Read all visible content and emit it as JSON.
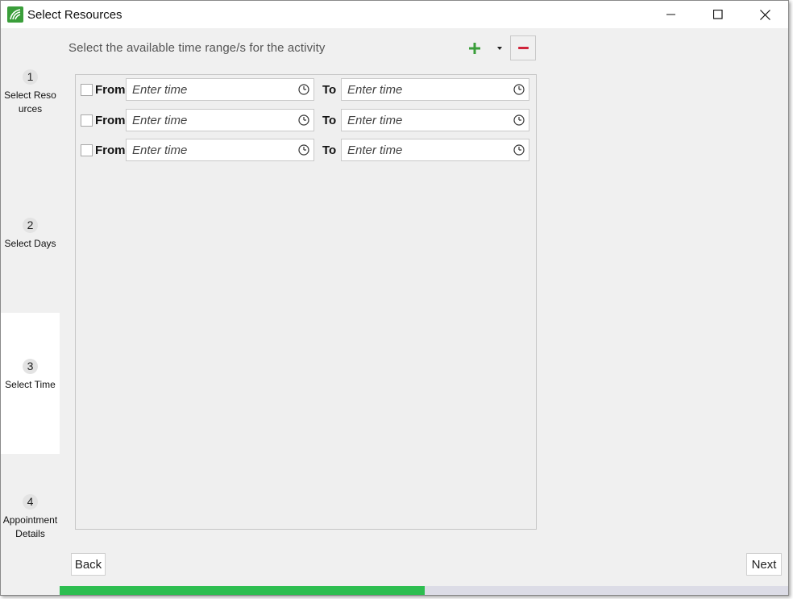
{
  "window": {
    "title": "Select Resources",
    "icon": "app-leaf-icon",
    "controls": [
      "minimize-icon",
      "maximize-icon",
      "close-icon"
    ]
  },
  "steps": [
    {
      "number": "1",
      "label": "Select Resources",
      "active": false
    },
    {
      "number": "2",
      "label": "Select Days",
      "active": false
    },
    {
      "number": "3",
      "label": "Select Time",
      "active": true
    },
    {
      "number": "4",
      "label": "Appointment Details",
      "active": false
    }
  ],
  "main": {
    "instruction": "Select the available time range/s for the activity",
    "add_icon": "plus-icon",
    "dropdown_icon": "dropdown-arrow-icon",
    "remove_icon": "minus-icon"
  },
  "time_ranges": {
    "from_label": "From",
    "to_label": "To",
    "rows": [
      {
        "checked": false,
        "from_placeholder": "Enter time",
        "to_placeholder": "Enter time"
      },
      {
        "checked": false,
        "from_placeholder": "Enter time",
        "to_placeholder": "Enter time"
      },
      {
        "checked": false,
        "from_placeholder": "Enter time",
        "to_placeholder": "Enter time"
      }
    ]
  },
  "footer": {
    "back_label": "Back",
    "next_label": "Next"
  },
  "progress": {
    "value": 0.5,
    "fill_color": "#2dbe50",
    "track_color": "#dcdce6"
  },
  "colors": {
    "accent_green": "#3a9e3a",
    "remove_red": "#d0243a"
  }
}
